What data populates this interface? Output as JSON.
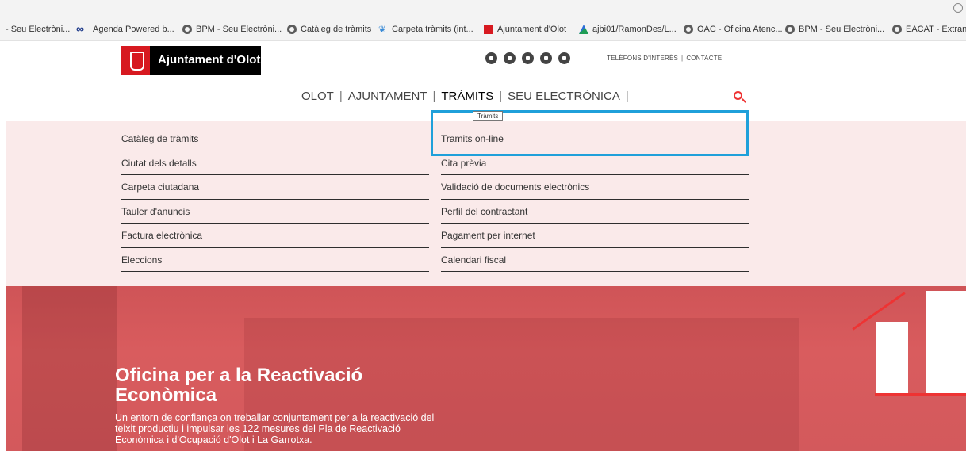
{
  "bookmarks": [
    {
      "label": "- Seu Electròni...",
      "icon": "none"
    },
    {
      "label": "Agenda Powered b...",
      "icon": "infinity-icon"
    },
    {
      "label": "BPM - Seu Electròni...",
      "icon": "globe-icon"
    },
    {
      "label": "Catàleg de tràmits",
      "icon": "globe-icon"
    },
    {
      "label": "Carpeta tràmits (int...",
      "icon": "leaf-icon"
    },
    {
      "label": "Ajuntament d'Olot",
      "icon": "ajuntament-icon"
    },
    {
      "label": "ajbi01/RamonDes/L...",
      "icon": "gitkraken-icon"
    },
    {
      "label": "OAC - Oficina Atenc...",
      "icon": "globe-icon"
    },
    {
      "label": "BPM - Seu Electròni...",
      "icon": "globe-icon"
    },
    {
      "label": "EACAT - Extrane",
      "icon": "globe-icon"
    }
  ],
  "header": {
    "brand": "Ajuntament d'Olot",
    "social": [
      "facebook-icon",
      "twitter-icon",
      "vimeo-icon",
      "instagram-icon",
      "linkedin-icon"
    ],
    "links": [
      "TELÈFONS D'INTERÈS",
      "CONTACTE"
    ],
    "link_sep": "|"
  },
  "nav": {
    "items": [
      "OLOT",
      "AJUNTAMENT",
      "TRÀMITS",
      "SEU ELECTRÒNICA"
    ],
    "sep": "|",
    "active": "TRÀMITS"
  },
  "dropdown": {
    "tooltip": "Tràmits",
    "left": [
      "Catàleg de tràmits",
      "Ciutat dels detalls",
      "Carpeta ciutadana",
      "Tauler d'anuncis",
      "Factura electrònica",
      "Eleccions"
    ],
    "right": [
      "Tramits on-line",
      "Cita prèvia",
      "Validació de documents electrònics",
      "Perfil del contractant",
      "Pagament per internet",
      "Calendari fiscal"
    ]
  },
  "hero": {
    "title": "Oficina per a la Reactivació Econòmica",
    "text": "Un entorn de confiança on treballar conjuntament per a la reactivació del teixit productiu i impulsar les 122 mesures del Pla de Reactivació Econòmica i d'Ocupació d'Olot i La Garrotxa."
  },
  "colors": {
    "highlight": "#1fa0da",
    "brand_red": "#d71920",
    "hero_bg": "#d95c5e"
  }
}
